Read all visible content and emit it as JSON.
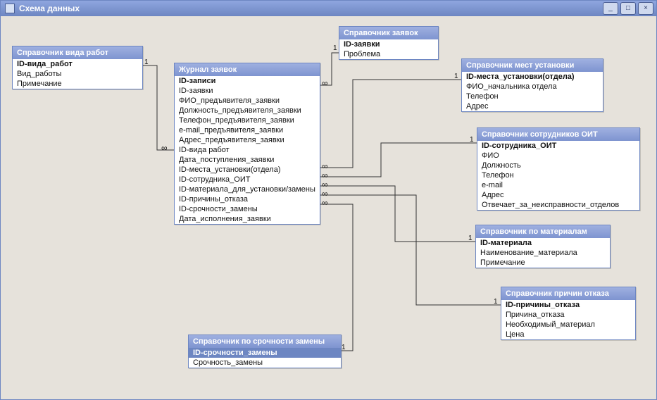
{
  "window": {
    "title": "Схема данных",
    "min_label": "_",
    "max_label": "□",
    "close_label": "×"
  },
  "tables": {
    "work_types": {
      "title": "Справочник вида работ",
      "fields": [
        "ID-вида_работ",
        "Вид_работы",
        "Примечание"
      ],
      "pk": [
        0
      ]
    },
    "journal": {
      "title": "Журнал заявок",
      "fields": [
        "ID-записи",
        "ID-заявки",
        "ФИО_предъявителя_заявки",
        "Должность_предъявителя_заявки",
        "Телефон_предъявителя_заявки",
        "e-mail_предъявителя_заявки",
        "Адрес_предъявителя_заявки",
        "ID-вида работ",
        "Дата_поступления_заявки",
        "ID-места_установки(отдела)",
        "ID-сотрудника_ОИТ",
        "ID-материала_для_установки/замены",
        "ID-причины_отказа",
        "ID-срочности_замены",
        "Дата_исполнения_заявки"
      ],
      "pk": [
        0
      ]
    },
    "requests": {
      "title": "Справочник заявок",
      "fields": [
        "ID-заявки",
        "Проблема"
      ],
      "pk": [
        0
      ]
    },
    "places": {
      "title": "Справочник мест установки",
      "fields": [
        "ID-места_установки(отдела)",
        "ФИО_начальника отдела",
        "Телефон",
        "Адрес"
      ],
      "pk": [
        0
      ]
    },
    "staff": {
      "title": "Справочник сотрудников ОИТ",
      "fields": [
        "ID-сотрудника_ОИТ",
        "ФИО",
        "Должность",
        "Телефон",
        "e-mail",
        "Адрес",
        "Отвечает_за_неисправности_отделов"
      ],
      "pk": [
        0
      ]
    },
    "materials": {
      "title": "Справочник по материалам",
      "fields": [
        "ID-материала",
        "Наименование_материала",
        "Примечание"
      ],
      "pk": [
        0
      ]
    },
    "reasons": {
      "title": "Справочник причин отказа",
      "fields": [
        "ID-причины_отказа",
        "Причина_отказа",
        "Необходимый_материал",
        "Цена"
      ],
      "pk": [
        0
      ]
    },
    "urgency": {
      "title": "Справочник по срочности замены",
      "fields": [
        "ID-срочности_замены",
        "Срочность_замены"
      ],
      "pk": [
        0
      ],
      "selected": [
        0
      ]
    }
  },
  "relations": [
    {
      "from": "work_types",
      "to": "journal",
      "type": "1:∞"
    },
    {
      "from": "requests",
      "to": "journal",
      "type": "1:∞"
    },
    {
      "from": "places",
      "to": "journal",
      "type": "1:∞"
    },
    {
      "from": "staff",
      "to": "journal",
      "type": "1:∞"
    },
    {
      "from": "materials",
      "to": "journal",
      "type": "1:∞"
    },
    {
      "from": "reasons",
      "to": "journal",
      "type": "1:∞"
    },
    {
      "from": "urgency",
      "to": "journal",
      "type": "1:∞"
    }
  ],
  "marks": {
    "one": "1",
    "many": "∞"
  }
}
